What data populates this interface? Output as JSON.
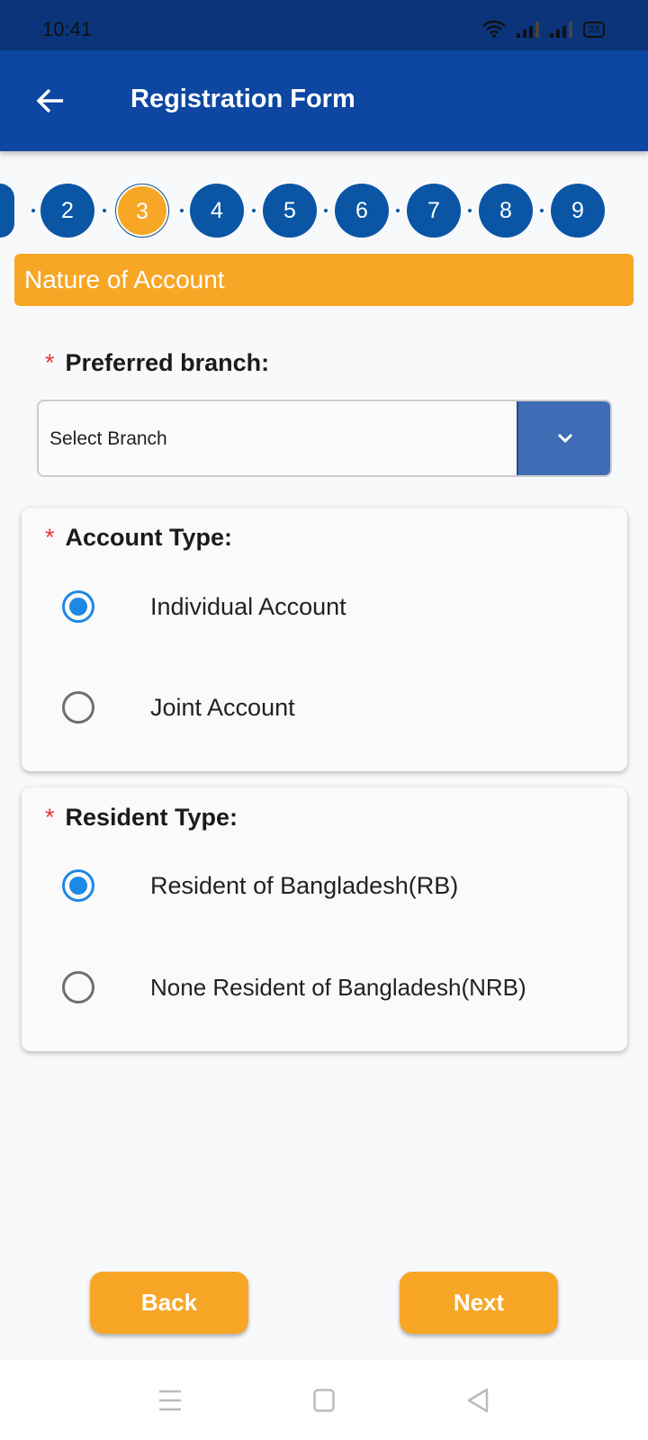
{
  "status_bar": {
    "time": "10:41",
    "battery": "23"
  },
  "app_bar": {
    "title": "Registration Form"
  },
  "stepper": {
    "steps": [
      "2",
      "3",
      "4",
      "5",
      "6",
      "7",
      "8",
      "9"
    ],
    "active": "3"
  },
  "section": {
    "title": "Nature of Account"
  },
  "branch": {
    "label": "Preferred branch:",
    "value": "Select Branch",
    "required": "*"
  },
  "account_type": {
    "label": "Account Type:",
    "required": "*",
    "options": [
      "Individual Account",
      "Joint Account"
    ],
    "selected": "Individual Account"
  },
  "resident_type": {
    "label": "Resident Type:",
    "required": "*",
    "options": [
      "Resident of Bangladesh(RB)",
      "None Resident of Bangladesh(NRB)"
    ],
    "selected": "Resident of Bangladesh(RB)"
  },
  "actions": {
    "back": "Back",
    "next": "Next"
  },
  "colors": {
    "primary": "#0d47a1",
    "accent": "#f7a626",
    "radio": "#1e88e5"
  }
}
